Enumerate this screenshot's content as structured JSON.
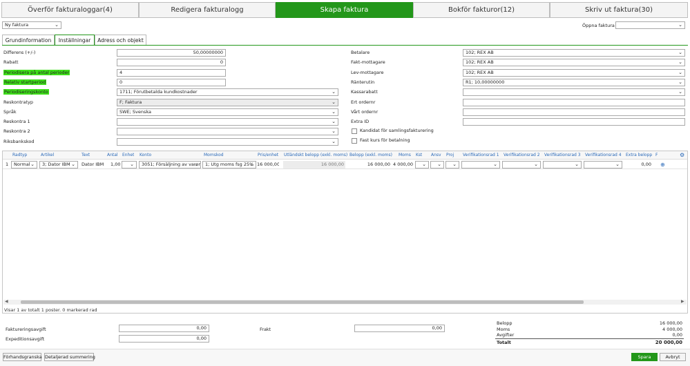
{
  "top_tabs": [
    {
      "label": "Överför fakturaloggar(4)"
    },
    {
      "label": "Redigera fakturalogg"
    },
    {
      "label": "Skapa faktura"
    },
    {
      "label": "Bokför fakturor(12)"
    },
    {
      "label": "Skriv ut faktura(30)"
    }
  ],
  "toolbar": {
    "new_invoice": "Ny faktura",
    "open_invoice_label": "Öppna faktura",
    "open_invoice_value": ""
  },
  "sub_tabs": [
    {
      "label": "Grundinformation"
    },
    {
      "label": "Inställningar"
    },
    {
      "label": "Adress och objekt"
    }
  ],
  "left_form": [
    {
      "label": "Differens (+/-)",
      "value": "50,00000000",
      "kind": "input-right",
      "highlight": false
    },
    {
      "label": "Rabatt",
      "value": "0",
      "kind": "input-right",
      "highlight": false
    },
    {
      "label": "Periodisera på antal perioder",
      "value": "4",
      "kind": "input",
      "highlight": true
    },
    {
      "label": "Relativ startperiod",
      "value": "0",
      "kind": "input",
      "highlight": true
    },
    {
      "label": "Periodiseringskonto",
      "value": "1711; Förutbetalda kundkostnader",
      "kind": "select",
      "highlight": true
    },
    {
      "label": "Reskontratyp",
      "value": "F; Faktura",
      "kind": "select-gray",
      "highlight": false
    },
    {
      "label": "Språk",
      "value": "SWE; Svenska",
      "kind": "select",
      "highlight": false
    },
    {
      "label": "Reskontra 1",
      "value": "",
      "kind": "select",
      "highlight": false
    },
    {
      "label": "Reskontra 2",
      "value": "",
      "kind": "select",
      "highlight": false
    },
    {
      "label": "Riksbankskod",
      "value": "",
      "kind": "select",
      "highlight": false
    }
  ],
  "right_form": [
    {
      "label": "Betalare",
      "value": "102; REX AB",
      "kind": "select"
    },
    {
      "label": "Fakt-mottagare",
      "value": "102; REX AB",
      "kind": "select"
    },
    {
      "label": "Lev-mottagare",
      "value": "102; REX AB",
      "kind": "select"
    },
    {
      "label": "Ränterutin",
      "value": "R1; 10,00000000",
      "kind": "select"
    },
    {
      "label": "Kassarabatt",
      "value": "",
      "kind": "select"
    },
    {
      "label": "Ert ordernr",
      "value": "",
      "kind": "input"
    },
    {
      "label": "Vårt ordernr",
      "value": "",
      "kind": "input"
    },
    {
      "label": "Extra ID",
      "value": "",
      "kind": "input"
    }
  ],
  "checkboxes": [
    {
      "label": "Kandidat för samlingsfakturering"
    },
    {
      "label": "Fast kurs för betalning"
    }
  ],
  "grid": {
    "headers": [
      "Radtyp",
      "Artikel",
      "Text",
      "Antal",
      "Enhet",
      "Konto",
      "Momskod",
      "Pris/enhet",
      "Utländskt belopp (exkl. moms)",
      "Belopp (exkl. moms)",
      "Moms",
      "Kst",
      "Ansv",
      "Proj",
      "Verifikationsrad 1",
      "Verifikationsrad 2",
      "Verifikationsrad 3",
      "Verifikationsrad 4",
      "Extra belopp",
      "F"
    ],
    "row": {
      "num": "1",
      "radtyp": "Normal",
      "artikel": "3; Dator IBM",
      "text": "Dator IBM",
      "antal": "1,00",
      "enhet": "",
      "konto": "3051; Försäljning av varor",
      "momskod": "1; Utg moms fsg 25%",
      "pris": "16 000,00",
      "utl": "16 000,00",
      "belopp": "16 000,00",
      "moms": "4 000,00",
      "extra": "0,00"
    },
    "status": "Visar 1 av totalt 1 poster. 0 markerad rad"
  },
  "footer": {
    "fakturering_label": "Faktureringsavgift",
    "fakturering_value": "0,00",
    "expedition_label": "Expeditionsavgift",
    "expedition_value": "0,00",
    "frakt_label": "Frakt",
    "frakt_value": "0,00",
    "summary": [
      {
        "label": "Belopp",
        "value": "16 000,00"
      },
      {
        "label": "Moms",
        "value": "4 000,00"
      },
      {
        "label": "Avgifter",
        "value": "0,00"
      },
      {
        "label": "Totalt",
        "value": "20 000,00"
      }
    ]
  },
  "buttons": {
    "preview": "Förhandsgranska",
    "detail": "Detaljerad summering",
    "save": "Spara",
    "cancel": "Avbryt"
  },
  "colors": {
    "accent": "#23971a",
    "highlight": "#3fe01a",
    "header_text": "#2868b8"
  }
}
